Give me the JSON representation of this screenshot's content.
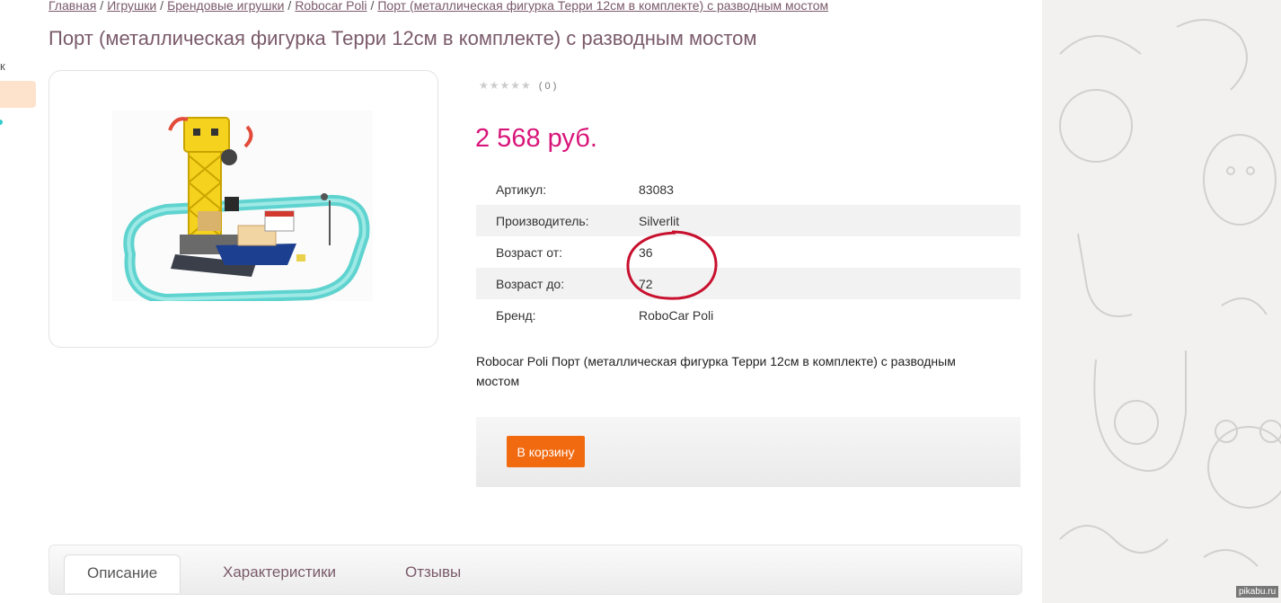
{
  "breadcrumb": {
    "items": [
      "Главная",
      "Игрушки",
      "Брендовые игрушки",
      "Robocar Poli",
      "Порт (металлическая фигурка Терри 12см в комплекте) с разводным мостом"
    ],
    "separator": "/"
  },
  "page_title": "Порт (металлическая фигурка Терри 12см в комплекте) с разводным мостом",
  "left_stub": {
    "text": "к"
  },
  "product": {
    "rating": {
      "stars": "★★★★★",
      "count": "( 0 )",
      "value": 0,
      "max": 5
    },
    "price": "2 568 руб.",
    "specs": [
      {
        "key": "Артикул:",
        "value": "83083"
      },
      {
        "key": "Производитель:",
        "value": "Silverlit"
      },
      {
        "key": "Возраст от:",
        "value": "36"
      },
      {
        "key": "Возраст до:",
        "value": "72"
      },
      {
        "key": "Бренд:",
        "value": "RoboCar Poli"
      }
    ],
    "description": "Robocar Poli Порт (металлическая фигурка Терри 12см в комплекте) с разводным мостом",
    "cart_button": "В корзину"
  },
  "tabs": [
    {
      "label": "Описание",
      "active": true
    },
    {
      "label": "Характеристики",
      "active": false
    },
    {
      "label": "Отзывы",
      "active": false
    }
  ],
  "watermark": "pikabu.ru",
  "colors": {
    "price": "#d8157a",
    "title": "#7a5a6a",
    "button": "#f16a10",
    "annotation_circle": "#c8102e"
  }
}
